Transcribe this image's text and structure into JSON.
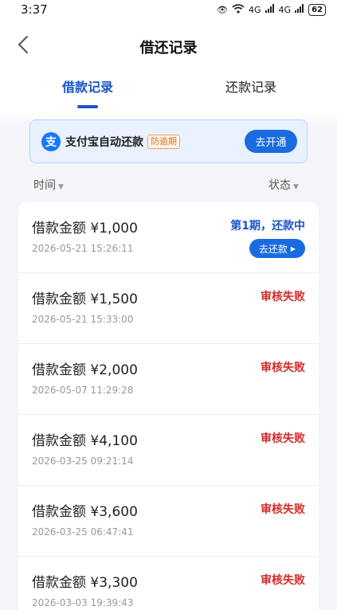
{
  "status_bar": {
    "time": "3:37",
    "signal_1": "4G",
    "signal_2": "4G",
    "battery": "62"
  },
  "nav": {
    "title": "借还记录"
  },
  "tabs": [
    {
      "label": "借款记录"
    },
    {
      "label": "还款记录"
    }
  ],
  "banner": {
    "icon_char": "支",
    "text": "支付宝自动还款",
    "badge": "防逾期",
    "button": "去开通"
  },
  "sort": {
    "time_label": "时间",
    "status_label": "状态"
  },
  "records": [
    {
      "amount": "借款金额 ¥1,000",
      "time": "2026-05-21 15:26:11",
      "status": "第1期，还款中",
      "action": "去还款"
    },
    {
      "amount": "借款金额 ¥1,500",
      "time": "2026-05-21 15:33:00",
      "status": "审核失败"
    },
    {
      "amount": "借款金额 ¥2,000",
      "time": "2026-05-07 11:29:28",
      "status": "审核失败"
    },
    {
      "amount": "借款金额 ¥4,100",
      "time": "2026-03-25 09:21:14",
      "status": "审核失败"
    },
    {
      "amount": "借款金额 ¥3,600",
      "time": "2026-03-25 06:47:41",
      "status": "审核失败"
    },
    {
      "amount": "借款金额 ¥3,300",
      "time": "2026-03-03 19:39:43",
      "status": "审核失败"
    }
  ],
  "colors": {
    "accent": "#1a56c7",
    "fail": "#d22a2a",
    "button": "#1a6be0"
  }
}
